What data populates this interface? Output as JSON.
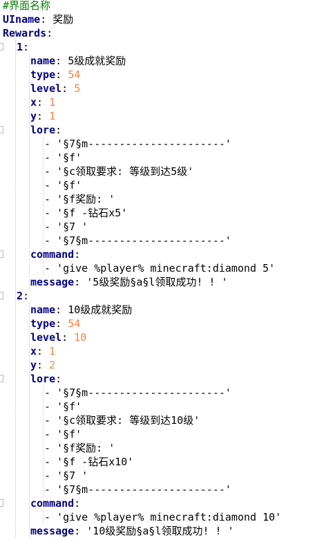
{
  "lines": [
    {
      "indent": 0,
      "parts": [
        {
          "t": "#界面名称",
          "c": "comment"
        }
      ]
    },
    {
      "indent": 0,
      "parts": [
        {
          "t": "UIname",
          "c": "key"
        },
        {
          "t": ": ",
          "c": "punct"
        },
        {
          "t": "奖励",
          "c": "str"
        }
      ]
    },
    {
      "indent": 0,
      "parts": [
        {
          "t": "Rewards",
          "c": "key"
        },
        {
          "t": ":",
          "c": "punct"
        }
      ]
    },
    {
      "indent": 2,
      "parts": [
        {
          "t": "1",
          "c": "key"
        },
        {
          "t": ":",
          "c": "punct"
        }
      ]
    },
    {
      "indent": 4,
      "parts": [
        {
          "t": "name",
          "c": "key"
        },
        {
          "t": ": ",
          "c": "punct"
        },
        {
          "t": "5级成就奖励",
          "c": "str"
        }
      ]
    },
    {
      "indent": 4,
      "parts": [
        {
          "t": "type",
          "c": "key"
        },
        {
          "t": ": ",
          "c": "punct"
        },
        {
          "t": "54",
          "c": "num"
        }
      ]
    },
    {
      "indent": 4,
      "parts": [
        {
          "t": "level",
          "c": "key"
        },
        {
          "t": ": ",
          "c": "punct"
        },
        {
          "t": "5",
          "c": "num"
        }
      ]
    },
    {
      "indent": 4,
      "parts": [
        {
          "t": "x",
          "c": "key"
        },
        {
          "t": ": ",
          "c": "punct"
        },
        {
          "t": "1",
          "c": "num"
        }
      ]
    },
    {
      "indent": 4,
      "parts": [
        {
          "t": "y",
          "c": "key"
        },
        {
          "t": ": ",
          "c": "punct"
        },
        {
          "t": "1",
          "c": "num"
        }
      ]
    },
    {
      "indent": 4,
      "parts": [
        {
          "t": "lore",
          "c": "key"
        },
        {
          "t": ":",
          "c": "punct"
        }
      ]
    },
    {
      "indent": 6,
      "parts": [
        {
          "t": "- '§7§m----------------------'",
          "c": "str"
        }
      ]
    },
    {
      "indent": 6,
      "parts": [
        {
          "t": "- '§f'",
          "c": "str"
        }
      ]
    },
    {
      "indent": 6,
      "parts": [
        {
          "t": "- '§c领取要求: 等级到达5级'",
          "c": "str"
        }
      ]
    },
    {
      "indent": 6,
      "parts": [
        {
          "t": "- '§f'",
          "c": "str"
        }
      ]
    },
    {
      "indent": 6,
      "parts": [
        {
          "t": "- '§f奖励: '",
          "c": "str"
        }
      ]
    },
    {
      "indent": 6,
      "parts": [
        {
          "t": "- '§f -钻石x5'",
          "c": "str"
        }
      ]
    },
    {
      "indent": 6,
      "parts": [
        {
          "t": "- '§7 '",
          "c": "str"
        }
      ]
    },
    {
      "indent": 6,
      "parts": [
        {
          "t": "- '§7§m----------------------'",
          "c": "str"
        }
      ]
    },
    {
      "indent": 4,
      "parts": [
        {
          "t": "command",
          "c": "key"
        },
        {
          "t": ":",
          "c": "punct"
        }
      ]
    },
    {
      "indent": 6,
      "parts": [
        {
          "t": "- 'give %player% minecraft:diamond 5'",
          "c": "str"
        }
      ]
    },
    {
      "indent": 4,
      "parts": [
        {
          "t": "message",
          "c": "key"
        },
        {
          "t": ": ",
          "c": "punct"
        },
        {
          "t": "'5级奖励§a§l领取成功! ! '",
          "c": "str"
        }
      ]
    },
    {
      "indent": 2,
      "parts": [
        {
          "t": "2",
          "c": "key"
        },
        {
          "t": ":",
          "c": "punct"
        }
      ]
    },
    {
      "indent": 4,
      "parts": [
        {
          "t": "name",
          "c": "key"
        },
        {
          "t": ": ",
          "c": "punct"
        },
        {
          "t": "10级成就奖励",
          "c": "str"
        }
      ]
    },
    {
      "indent": 4,
      "parts": [
        {
          "t": "type",
          "c": "key"
        },
        {
          "t": ": ",
          "c": "punct"
        },
        {
          "t": "54",
          "c": "num"
        }
      ]
    },
    {
      "indent": 4,
      "parts": [
        {
          "t": "level",
          "c": "key"
        },
        {
          "t": ": ",
          "c": "punct"
        },
        {
          "t": "10",
          "c": "num"
        }
      ]
    },
    {
      "indent": 4,
      "parts": [
        {
          "t": "x",
          "c": "key"
        },
        {
          "t": ": ",
          "c": "punct"
        },
        {
          "t": "1",
          "c": "num"
        }
      ]
    },
    {
      "indent": 4,
      "parts": [
        {
          "t": "y",
          "c": "key"
        },
        {
          "t": ": ",
          "c": "punct"
        },
        {
          "t": "2",
          "c": "num"
        }
      ]
    },
    {
      "indent": 4,
      "parts": [
        {
          "t": "lore",
          "c": "key"
        },
        {
          "t": ":",
          "c": "punct"
        }
      ]
    },
    {
      "indent": 6,
      "parts": [
        {
          "t": "- '§7§m----------------------'",
          "c": "str"
        }
      ]
    },
    {
      "indent": 6,
      "parts": [
        {
          "t": "- '§f'",
          "c": "str"
        }
      ]
    },
    {
      "indent": 6,
      "parts": [
        {
          "t": "- '§c领取要求: 等级到达10级'",
          "c": "str"
        }
      ]
    },
    {
      "indent": 6,
      "parts": [
        {
          "t": "- '§f'",
          "c": "str"
        }
      ]
    },
    {
      "indent": 6,
      "parts": [
        {
          "t": "- '§f奖励: '",
          "c": "str"
        }
      ]
    },
    {
      "indent": 6,
      "parts": [
        {
          "t": "- '§f -钻石x10'",
          "c": "str"
        }
      ]
    },
    {
      "indent": 6,
      "parts": [
        {
          "t": "- '§7 '",
          "c": "str"
        }
      ]
    },
    {
      "indent": 6,
      "parts": [
        {
          "t": "- '§7§m----------------------'",
          "c": "str"
        }
      ]
    },
    {
      "indent": 4,
      "parts": [
        {
          "t": "command",
          "c": "key"
        },
        {
          "t": ":",
          "c": "punct"
        }
      ]
    },
    {
      "indent": 6,
      "parts": [
        {
          "t": "- 'give %player% minecraft:diamond 10'",
          "c": "str"
        }
      ]
    },
    {
      "indent": 4,
      "parts": [
        {
          "t": "message",
          "c": "key"
        },
        {
          "t": ": ",
          "c": "punct"
        },
        {
          "t": "'10级奖励§a§l领取成功! ! '",
          "c": "str"
        }
      ]
    }
  ],
  "colors": {
    "comment": "#008000",
    "key": "#000080",
    "number": "#ff8040",
    "text": "#000000"
  }
}
